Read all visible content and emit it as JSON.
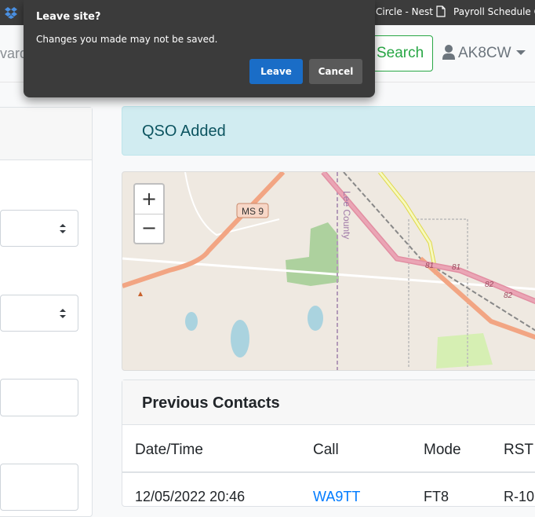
{
  "bookmarks": {
    "items": [
      {
        "label": "Circle - Nest"
      },
      {
        "label": "Payroll Schedule Ca"
      }
    ]
  },
  "navbar": {
    "partial_input_text": "vard",
    "search_label": "Search",
    "user_label": "AK8CW"
  },
  "alert": {
    "text": "QSO Added"
  },
  "map": {
    "labels": {
      "highway": "MS 9",
      "county": "Lee County",
      "exit_81a": "81",
      "exit_81b": "81",
      "exit_82a": "82",
      "exit_82b": "82"
    },
    "zoom_in": "+",
    "zoom_out": "−"
  },
  "contacts": {
    "title": "Previous Contacts",
    "columns": [
      "Date/Time",
      "Call",
      "Mode",
      "RST ("
    ],
    "rows": [
      {
        "datetime": "12/05/2022 20:46",
        "call": "WA9TT",
        "mode": "FT8",
        "rst": "R-10"
      }
    ]
  },
  "dialog": {
    "title": "Leave site?",
    "message": "Changes you made may not be saved.",
    "leave_label": "Leave",
    "cancel_label": "Cancel"
  },
  "colors": {
    "accent_blue": "#007bff",
    "success_green": "#28a745",
    "alert_bg": "#d1ecf1",
    "dialog_bg": "#3b3b3b",
    "leave_button": "#1a6dc7"
  }
}
